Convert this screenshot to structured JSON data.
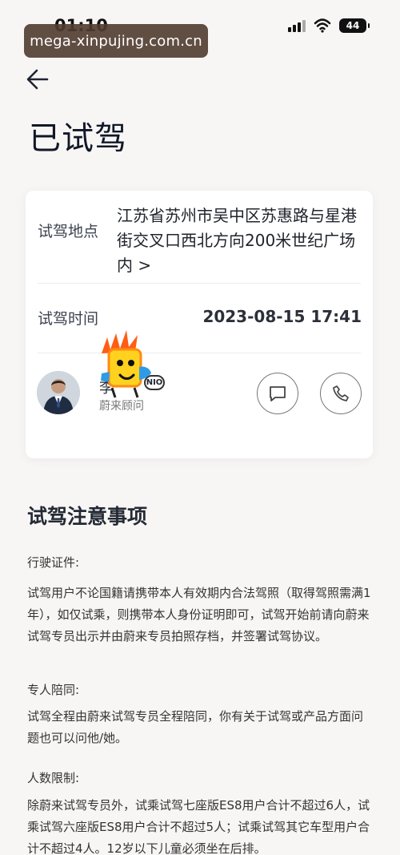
{
  "status_bar": {
    "time": "01:10",
    "battery": "44"
  },
  "watermark": "mega-xinpujing.com.cn",
  "page": {
    "title": "已试驾"
  },
  "card": {
    "location_label": "试驾地点",
    "location_value": "江苏省苏州市吴中区苏惠路与星港街交叉口西北方向200米世纪广场内 >",
    "time_label": "试驾时间",
    "time_value": "2023-08-15 17:41",
    "advisor": {
      "name": "李",
      "badge": "NIO",
      "role": "蔚来顾问"
    }
  },
  "notes": {
    "title": "试驾注意事项",
    "sections": [
      {
        "label": "行驶证件:",
        "text": "试驾用户不论国籍请携带本人有效期内合法驾照（取得驾照需满1年），如仅试乘，则携带本人身份证明即可，试驾开始前请向蔚来试驾专员出示并由蔚来专员拍照存档，并签署试驾协议。"
      },
      {
        "label": "专人陪同:",
        "text": "试驾全程由蔚来试驾专员全程陪同，你有关于试驾或产品方面问题也可以问他/她。"
      },
      {
        "label": "人数限制:",
        "text": "除蔚来试驾专员外，试乘试驾七座版ES8用户合计不超过6人，试乘试驾六座版ES8用户合计不超过5人；试乘试驾其它车型用户合计不超过4人。12岁以下儿童必须坐在后排。"
      }
    ]
  },
  "colors": {
    "background": "#f8f6f5",
    "card": "#ffffff",
    "text": "#1f2430",
    "watermark": "#503c30"
  },
  "icons": {
    "back": "arrow-left-icon",
    "chat": "chat-bubble-icon",
    "phone": "phone-icon",
    "wifi": "wifi-icon",
    "signal": "signal-icon",
    "battery": "battery-icon"
  }
}
